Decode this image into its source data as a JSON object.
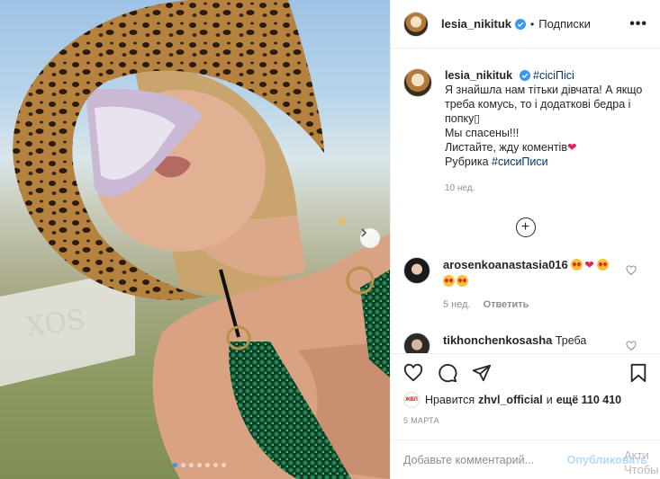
{
  "post": {
    "author": "lesia_nikituk",
    "follow_label": "Подписки",
    "more_label": "•••"
  },
  "caption": {
    "author": "lesia_nikituk",
    "hashtag1": "#сісіПісі",
    "line1": "Я знайшла нам тітьки дівчата! А якщо треба комусь, то і додаткові бедра і попку",
    "line2": "Мы спасены!!!",
    "line3": "Листайте, жду коментів",
    "line4_prefix": "Рубрика",
    "hashtag2": "#сисиПиси",
    "time": "10 нед."
  },
  "comments": [
    {
      "author": "arosenkoanastasia016",
      "time": "5 нед.",
      "reply_label": "Ответить"
    },
    {
      "author": "tikhonchenkosasha",
      "text": "Треба"
    }
  ],
  "likes": {
    "avatar_text": "ЖВЛ",
    "prefix": "Нравится",
    "user": "zhvl_official",
    "and": "и",
    "count": "ещё 110 410"
  },
  "date": "5 МАРТА",
  "comment_box": {
    "placeholder": "Добавьте комментарий...",
    "post_label": "Опубликовать"
  },
  "overlay": {
    "line1": "Акти",
    "line2": "Чтобы"
  },
  "carousel": {
    "total": 7,
    "active": 0
  },
  "colors": {
    "accent": "#3897f0",
    "verified": "#3897f0",
    "heart": "#e0245e"
  }
}
